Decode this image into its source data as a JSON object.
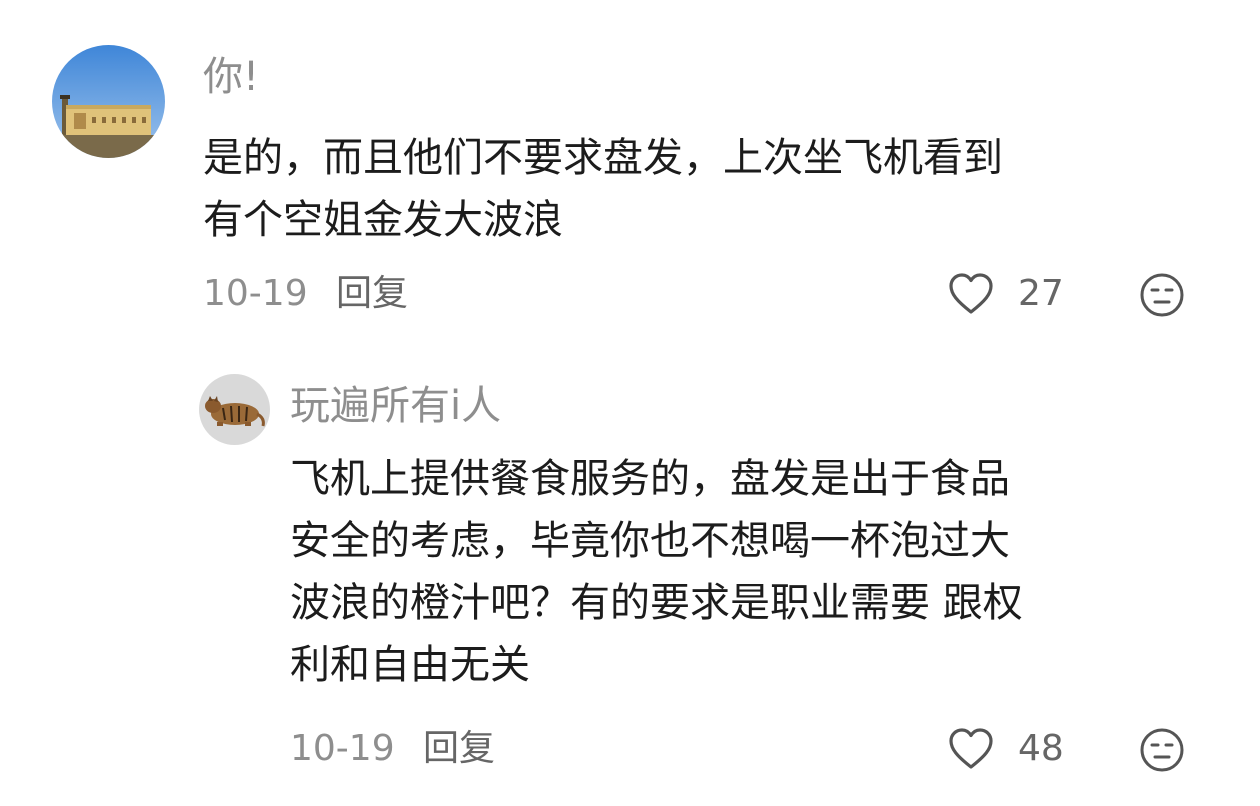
{
  "colors": {
    "username": "#8e8e8e",
    "text": "#1c1c1c",
    "meta": "#8e8e8e",
    "icon_stroke": "#555555",
    "background": "#ffffff"
  },
  "comments": [
    {
      "username": "你!",
      "text_lines": [
        "是的，而且他们不要求盘发，上次坐飞机看到",
        "有个空姐金发大波浪"
      ],
      "date": "10-19",
      "reply_label": "回复",
      "like_count": "27",
      "like_icon": "heart-outline-icon",
      "dislike_icon": "neutral-face-icon"
    },
    {
      "username": "玩遍所有i人",
      "text_lines": [
        "飞机上提供餐食服务的，盘发是出于食品",
        "安全的考虑，毕竟你也不想喝一杯泡过大",
        "波浪的橙汁吧？有的要求是职业需要 跟权",
        "利和自由无关"
      ],
      "date": "10-19",
      "reply_label": "回复",
      "like_count": "48",
      "like_icon": "heart-outline-icon",
      "dislike_icon": "neutral-face-icon"
    }
  ]
}
